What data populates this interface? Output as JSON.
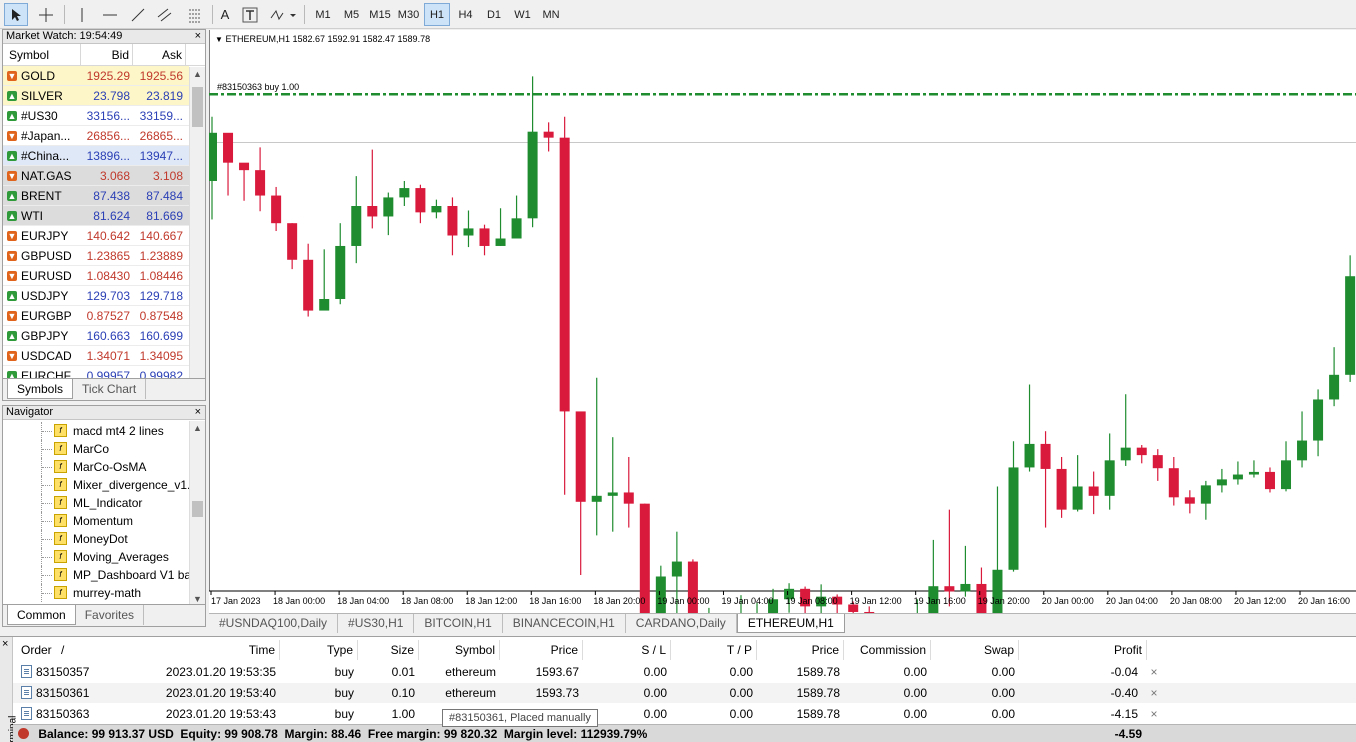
{
  "toolbar": {
    "tool_icons": [
      "cursor-icon",
      "crosshair-icon",
      "vertical-line-icon",
      "horizontal-line-icon",
      "trendline-icon",
      "equidistant-channel-icon",
      "fibonacci-icon",
      "text-icon",
      "text-label-icon",
      "shapes-icon"
    ],
    "text_tool": "A",
    "timeframes": [
      "M1",
      "M5",
      "M15",
      "M30",
      "H1",
      "H4",
      "D1",
      "W1",
      "MN"
    ],
    "active_timeframe": "H1"
  },
  "market_watch": {
    "title": "Market Watch: 19:54:49",
    "headers": {
      "symbol": "Symbol",
      "bid": "Bid",
      "ask": "Ask"
    },
    "rows": [
      {
        "symbol": "GOLD",
        "bid": "1925.29",
        "ask": "1925.56",
        "dir": "down",
        "bg": "#fdf6c9",
        "color": "#c0392b"
      },
      {
        "symbol": "SILVER",
        "bid": "23.798",
        "ask": "23.819",
        "dir": "up",
        "bg": "#fdf6c9",
        "color": "#2a3fb5"
      },
      {
        "symbol": "#US30",
        "bid": "33156...",
        "ask": "33159...",
        "dir": "up",
        "bg": "#ffffff",
        "color": "#2a3fb5"
      },
      {
        "symbol": "#Japan...",
        "bid": "26856...",
        "ask": "26865...",
        "dir": "down",
        "bg": "#ffffff",
        "color": "#c0392b"
      },
      {
        "symbol": "#China...",
        "bid": "13896...",
        "ask": "13947...",
        "dir": "up",
        "bg": "#dfe8f7",
        "color": "#2a3fb5"
      },
      {
        "symbol": "NAT.GAS",
        "bid": "3.068",
        "ask": "3.108",
        "dir": "down",
        "bg": "#dcdcdc",
        "color": "#c0392b"
      },
      {
        "symbol": "BRENT",
        "bid": "87.438",
        "ask": "87.484",
        "dir": "up",
        "bg": "#dcdcdc",
        "color": "#2a3fb5"
      },
      {
        "symbol": "WTI",
        "bid": "81.624",
        "ask": "81.669",
        "dir": "up",
        "bg": "#dcdcdc",
        "color": "#2a3fb5"
      },
      {
        "symbol": "EURJPY",
        "bid": "140.642",
        "ask": "140.667",
        "dir": "down",
        "bg": "#ffffff",
        "color": "#c0392b"
      },
      {
        "symbol": "GBPUSD",
        "bid": "1.23865",
        "ask": "1.23889",
        "dir": "down",
        "bg": "#ffffff",
        "color": "#c0392b"
      },
      {
        "symbol": "EURUSD",
        "bid": "1.08430",
        "ask": "1.08446",
        "dir": "down",
        "bg": "#ffffff",
        "color": "#c0392b"
      },
      {
        "symbol": "USDJPY",
        "bid": "129.703",
        "ask": "129.718",
        "dir": "up",
        "bg": "#ffffff",
        "color": "#2a3fb5"
      },
      {
        "symbol": "EURGBP",
        "bid": "0.87527",
        "ask": "0.87548",
        "dir": "down",
        "bg": "#ffffff",
        "color": "#c0392b"
      },
      {
        "symbol": "GBPJPY",
        "bid": "160.663",
        "ask": "160.699",
        "dir": "up",
        "bg": "#ffffff",
        "color": "#2a3fb5"
      },
      {
        "symbol": "USDCAD",
        "bid": "1.34071",
        "ask": "1.34095",
        "dir": "down",
        "bg": "#ffffff",
        "color": "#c0392b"
      },
      {
        "symbol": "EURCHF",
        "bid": "0.99957",
        "ask": "0.99982",
        "dir": "up",
        "bg": "#ffffff",
        "color": "#2a3fb5"
      }
    ],
    "tabs": [
      "Symbols",
      "Tick Chart"
    ]
  },
  "navigator": {
    "title": "Navigator",
    "items": [
      "macd mt4 2 lines",
      "MarCo",
      "MarCo-OsMA",
      "Mixer_divergence_v1.",
      "ML_Indicator",
      "Momentum",
      "MoneyDot",
      "Moving_Averages",
      "MP_Dashboard V1 ba",
      "murrey-math"
    ],
    "tabs": [
      "Common",
      "Favorites"
    ]
  },
  "chart": {
    "header": "ETHEREUM,H1  1582.67 1592.91 1582.47 1589.78",
    "order_label": "#83150363 buy 1.00",
    "colors": {
      "bull": "#1e8c2f",
      "bear": "#d91a3c",
      "order_line": "#1e8c2f"
    },
    "tabs": [
      "#USNDAQ100,Daily",
      "#US30,H1",
      "BITCOIN,H1",
      "BINANCECOIN,H1",
      "CARDANO,Daily",
      "ETHEREUM,H1"
    ],
    "active_tab": "ETHEREUM,H1"
  },
  "chart_data": {
    "type": "candlestick",
    "title": "ETHEREUM,H1",
    "x_ticks": [
      "17 Jan 2023",
      "18 Jan 00:00",
      "18 Jan 04:00",
      "18 Jan 08:00",
      "18 Jan 12:00",
      "18 Jan 16:00",
      "18 Jan 20:00",
      "19 Jan 00:00",
      "19 Jan 04:00",
      "19 Jan 08:00",
      "19 Jan 12:00",
      "19 Jan 16:00",
      "19 Jan 20:00",
      "20 Jan 00:00",
      "20 Jan 04:00",
      "20 Jan 08:00",
      "20 Jan 12:00",
      "20 Jan 16:00"
    ],
    "order_price": 1593.73,
    "candles": [
      [
        1570.5,
        1583.4,
        1587.7,
        1560.2
      ],
      [
        1583.4,
        1575.4,
        1582.4,
        1566.6
      ],
      [
        1575.4,
        1573.4,
        1574.8,
        1565.2
      ],
      [
        1573.4,
        1566.6,
        1579.5,
        1562.4
      ],
      [
        1566.6,
        1559.2,
        1568.9,
        1557.1
      ],
      [
        1559.2,
        1549.4,
        1559.2,
        1546.9
      ],
      [
        1549.4,
        1535.8,
        1553.7,
        1534.2
      ],
      [
        1535.8,
        1538.9,
        1552.2,
        1537.2
      ],
      [
        1538.9,
        1553.1,
        1559.2,
        1537.5
      ],
      [
        1553.1,
        1563.8,
        1571.8,
        1548.5
      ],
      [
        1563.8,
        1561.0,
        1578.9,
        1557.8
      ],
      [
        1561.0,
        1566.1,
        1567.4,
        1556.0
      ],
      [
        1566.1,
        1568.6,
        1570.5,
        1563.8
      ],
      [
        1568.6,
        1562.1,
        1569.5,
        1559.2
      ],
      [
        1562.1,
        1563.8,
        1565.5,
        1560.5
      ],
      [
        1563.8,
        1555.9,
        1566.1,
        1550.6
      ],
      [
        1555.9,
        1557.8,
        1562.6,
        1552.8
      ],
      [
        1557.8,
        1553.1,
        1558.8,
        1550.6
      ],
      [
        1553.1,
        1555.1,
        1563.2,
        1553.1
      ],
      [
        1555.1,
        1560.5,
        1566.6,
        1558.1
      ],
      [
        1560.5,
        1583.7,
        1598.5,
        1558.1
      ],
      [
        1583.7,
        1582.1,
        1586.2,
        1578.4
      ],
      [
        1582.1,
        1508.8,
        1587.7,
        1486.5
      ],
      [
        1508.8,
        1484.6,
        1496.0,
        1465.0
      ],
      [
        1484.6,
        1486.2,
        1517.8,
        1475.6
      ],
      [
        1486.2,
        1487.1,
        1501.9,
        1476.6
      ],
      [
        1487.1,
        1484.1,
        1496.6,
        1477.7
      ],
      [
        1484.1,
        1453.7,
        1484.1,
        1449.2
      ],
      [
        1453.7,
        1464.6,
        1467.5,
        1448.7
      ],
      [
        1464.6,
        1468.6,
        1476.6,
        1454.6
      ],
      [
        1468.6,
        1432.9,
        1469.2,
        1427.7
      ],
      [
        1432.9,
        1439.3,
        1456.2,
        1432.3
      ],
      [
        1439.3,
        1441.5,
        1445.6,
        1434.2
      ],
      [
        1441.5,
        1452.0,
        1459.6,
        1437.9
      ],
      [
        1452.0,
        1452.6,
        1457.5,
        1448.9
      ],
      [
        1452.6,
        1458.5,
        1461.3,
        1452.1
      ],
      [
        1458.5,
        1461.3,
        1462.8,
        1454.9
      ],
      [
        1461.3,
        1456.6,
        1461.9,
        1451.6
      ],
      [
        1456.6,
        1459.2,
        1462.5,
        1451.6
      ],
      [
        1459.2,
        1457.1,
        1459.8,
        1452.4
      ],
      [
        1457.1,
        1455.1,
        1457.9,
        1450.5
      ],
      [
        1455.1,
        1449.7,
        1456.6,
        1446.1
      ],
      [
        1449.7,
        1447.4,
        1453.7,
        1444.1
      ],
      [
        1447.4,
        1446.1,
        1451.0,
        1440.0
      ],
      [
        1446.1,
        1449.7,
        1458.5,
        1444.1
      ],
      [
        1449.7,
        1462.0,
        1474.4,
        1447.7
      ],
      [
        1462.0,
        1460.6,
        1482.5,
        1456.6
      ],
      [
        1460.6,
        1462.6,
        1472.8,
        1459.2
      ],
      [
        1462.6,
        1454.1,
        1467.0,
        1450.5
      ],
      [
        1454.1,
        1466.4,
        1488.7,
        1453.1
      ],
      [
        1466.4,
        1493.8,
        1500.8,
        1465.9
      ],
      [
        1493.8,
        1500.1,
        1516.0,
        1492.7
      ],
      [
        1500.1,
        1493.4,
        1503.5,
        1477.7
      ],
      [
        1493.4,
        1482.5,
        1496.6,
        1480.3
      ],
      [
        1482.5,
        1488.7,
        1497.1,
        1482.0
      ],
      [
        1488.7,
        1486.2,
        1492.7,
        1481.3
      ],
      [
        1486.2,
        1495.7,
        1502.9,
        1482.5
      ],
      [
        1495.7,
        1499.1,
        1513.4,
        1494.2
      ],
      [
        1499.1,
        1497.1,
        1499.8,
        1494.9
      ],
      [
        1497.1,
        1493.6,
        1498.7,
        1490.2
      ],
      [
        1493.6,
        1485.8,
        1496.6,
        1483.6
      ],
      [
        1485.8,
        1484.1,
        1487.7,
        1481.5
      ],
      [
        1484.1,
        1489.0,
        1490.2,
        1479.8
      ],
      [
        1489.0,
        1490.6,
        1493.4,
        1487.1
      ],
      [
        1490.6,
        1491.9,
        1495.4,
        1489.2
      ],
      [
        1491.9,
        1492.6,
        1495.7,
        1491.1
      ],
      [
        1492.6,
        1488.0,
        1493.8,
        1487.1
      ],
      [
        1488.0,
        1495.7,
        1500.8,
        1487.4
      ],
      [
        1495.7,
        1501.0,
        1508.8,
        1493.8
      ],
      [
        1501.0,
        1512.0,
        1514.7,
        1496.8
      ],
      [
        1512.0,
        1518.6,
        1526.0,
        1510.2
      ],
      [
        1518.6,
        1545.0,
        1550.6,
        1516.7
      ],
      [
        1545.0,
        1571.1,
        1576.7,
        1534.3
      ],
      [
        1571.1,
        1580.8,
        1589.8,
        1567.4
      ]
    ]
  },
  "terminal": {
    "headers": [
      "Order",
      "/",
      "Time",
      "Type",
      "Size",
      "Symbol",
      "Price",
      "S / L",
      "T / P",
      "Price",
      "Commission",
      "Swap",
      "Profit"
    ],
    "rows": [
      {
        "order": "83150357",
        "time": "2023.01.20 19:53:35",
        "type": "buy",
        "size": "0.01",
        "symbol": "ethereum",
        "price": "1593.67",
        "sl": "0.00",
        "tp": "0.00",
        "cur_price": "1589.78",
        "commission": "0.00",
        "swap": "0.00",
        "profit": "-0.04"
      },
      {
        "order": "83150361",
        "time": "2023.01.20 19:53:40",
        "type": "buy",
        "size": "0.10",
        "symbol": "ethereum",
        "price": "1593.73",
        "sl": "0.00",
        "tp": "0.00",
        "cur_price": "1589.78",
        "commission": "0.00",
        "swap": "0.00",
        "profit": "-0.40"
      },
      {
        "order": "83150363",
        "time": "2023.01.20 19:53:43",
        "type": "buy",
        "size": "1.00",
        "symbol": "ethereum",
        "price": "1593.73",
        "sl": "0.00",
        "tp": "0.00",
        "cur_price": "1589.78",
        "commission": "0.00",
        "swap": "0.00",
        "profit": "-4.15"
      }
    ],
    "close_glyph": "×",
    "balance_line": "Balance: 99 913.37 USD  Equity: 99 908.78  Margin: 88.46  Free margin: 99 820.32  Margin level: 112939.79%",
    "total_profit": "-4.59",
    "tooltip": "#83150361, Placed manually",
    "side_label": "Terminal"
  }
}
